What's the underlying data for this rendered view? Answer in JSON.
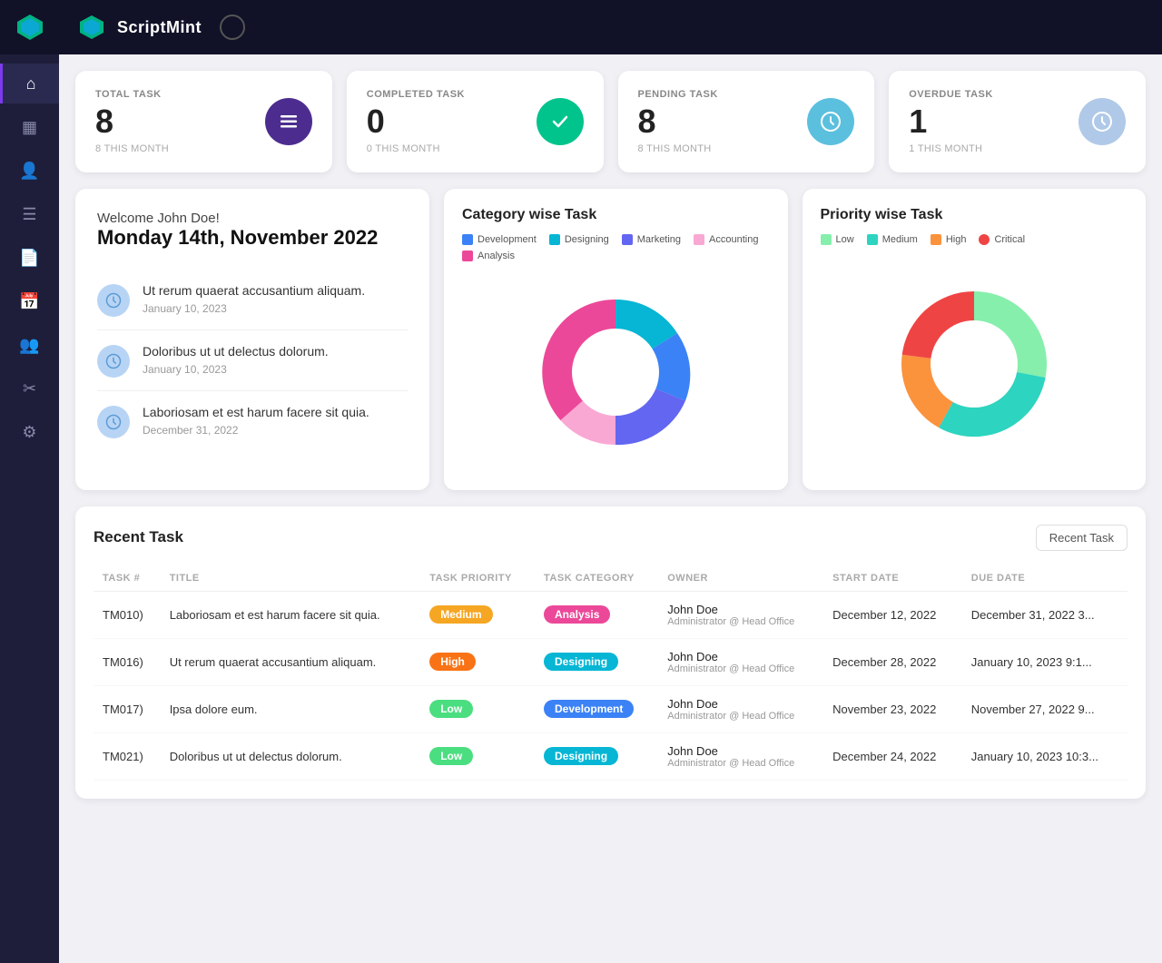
{
  "app": {
    "name": "ScriptMint",
    "circle_indicator": ""
  },
  "sidebar": {
    "items": [
      {
        "id": "home",
        "icon": "⌂",
        "active": true
      },
      {
        "id": "dashboard",
        "icon": "▦",
        "active": false
      },
      {
        "id": "users",
        "icon": "👤",
        "active": false
      },
      {
        "id": "tasks",
        "icon": "☰",
        "active": false
      },
      {
        "id": "reports",
        "icon": "📄",
        "active": false
      },
      {
        "id": "calendar",
        "icon": "📅",
        "active": false
      },
      {
        "id": "team",
        "icon": "👥",
        "active": false
      },
      {
        "id": "tools",
        "icon": "🔧",
        "active": false
      },
      {
        "id": "settings",
        "icon": "⚙",
        "active": false
      }
    ]
  },
  "stats": [
    {
      "id": "total-task",
      "label": "TOTAL TASK",
      "value": "8",
      "sub": "8 THIS MONTH",
      "icon_color": "#4c2d8f",
      "icon": "≡"
    },
    {
      "id": "completed-task",
      "label": "COMPLETED TASK",
      "value": "0",
      "sub": "0 THIS MONTH",
      "icon_color": "#00c48c",
      "icon": "✓"
    },
    {
      "id": "pending-task",
      "label": "PENDING TASK",
      "value": "8",
      "sub": "8 THIS MONTH",
      "icon_color": "#5bc0de",
      "icon": "🕐"
    },
    {
      "id": "overdue-task",
      "label": "OVERDUE TASK",
      "value": "1",
      "sub": "1 THIS MONTH",
      "icon_color": "#b0c9e8",
      "icon": "🕐"
    }
  ],
  "welcome": {
    "greeting": "Welcome John Doe!",
    "date": "Monday 14th, November 2022",
    "tasks": [
      {
        "text": "Ut rerum quaerat accusantium aliquam.",
        "date": "January 10, 2023"
      },
      {
        "text": "Doloribus ut ut delectus dolorum.",
        "date": "January 10, 2023"
      },
      {
        "text": "Laboriosam et est harum facere sit quia.",
        "date": "December 31, 2022"
      }
    ]
  },
  "category_chart": {
    "title": "Category wise Task",
    "legend": [
      {
        "label": "Development",
        "color": "#3b82f6"
      },
      {
        "label": "Designing",
        "color": "#06b6d4"
      },
      {
        "label": "Marketing",
        "color": "#6366f1"
      },
      {
        "label": "Accounting",
        "color": "#f472b6"
      },
      {
        "label": "Analysis",
        "color": "#ec4899"
      }
    ],
    "segments": [
      {
        "label": "Development",
        "color": "#06b6d4",
        "value": 20
      },
      {
        "label": "Designing",
        "color": "#3b82f6",
        "value": 15
      },
      {
        "label": "Marketing",
        "color": "#6366f1",
        "value": 20
      },
      {
        "label": "Accounting",
        "color": "#f9a8d4",
        "value": 15
      },
      {
        "label": "Analysis",
        "color": "#ec4899",
        "value": 30
      }
    ]
  },
  "priority_chart": {
    "title": "Priority wise Task",
    "legend": [
      {
        "label": "Low",
        "color": "#86efac"
      },
      {
        "label": "Medium",
        "color": "#2dd4bf"
      },
      {
        "label": "High",
        "color": "#fb923c"
      },
      {
        "label": "Critical",
        "color": "#ef4444"
      }
    ],
    "segments": [
      {
        "label": "Low",
        "color": "#86efac",
        "value": 28
      },
      {
        "label": "Medium",
        "color": "#2dd4bf",
        "value": 30
      },
      {
        "label": "High",
        "color": "#fb923c",
        "value": 15
      },
      {
        "label": "Critical",
        "color": "#ef4444",
        "value": 27
      }
    ]
  },
  "recent_task": {
    "title": "Recent Task",
    "tab_label": "Recent Task",
    "columns": [
      "TASK #",
      "TITLE",
      "TASK PRIORITY",
      "TASK CATEGORY",
      "OWNER",
      "START DATE",
      "DUE DATE"
    ],
    "rows": [
      {
        "task_num": "TM010)",
        "title": "Laboriosam et est harum facere sit quia.",
        "priority": "Medium",
        "priority_class": "badge-medium",
        "category": "Analysis",
        "category_class": "badge-analysis",
        "owner_name": "John Doe",
        "owner_sub": "Administrator @ Head Office",
        "start_date": "December 12, 2022",
        "due_date": "December 31, 2022 3..."
      },
      {
        "task_num": "TM016)",
        "title": "Ut rerum quaerat accusantium aliquam.",
        "priority": "High",
        "priority_class": "badge-high",
        "category": "Designing",
        "category_class": "badge-designing",
        "owner_name": "John Doe",
        "owner_sub": "Administrator @ Head Office",
        "start_date": "December 28, 2022",
        "due_date": "January 10, 2023 9:1..."
      },
      {
        "task_num": "TM017)",
        "title": "Ipsa dolore eum.",
        "priority": "Low",
        "priority_class": "badge-low",
        "category": "Development",
        "category_class": "badge-development",
        "owner_name": "John Doe",
        "owner_sub": "Administrator @ Head Office",
        "start_date": "November 23, 2022",
        "due_date": "November 27, 2022 9..."
      },
      {
        "task_num": "TM021)",
        "title": "Doloribus ut ut delectus dolorum.",
        "priority": "Low",
        "priority_class": "badge-low",
        "category": "Designing",
        "category_class": "badge-designing",
        "owner_name": "John Doe",
        "owner_sub": "Administrator @ Head Office",
        "start_date": "December 24, 2022",
        "due_date": "January 10, 2023 10:3..."
      }
    ]
  }
}
